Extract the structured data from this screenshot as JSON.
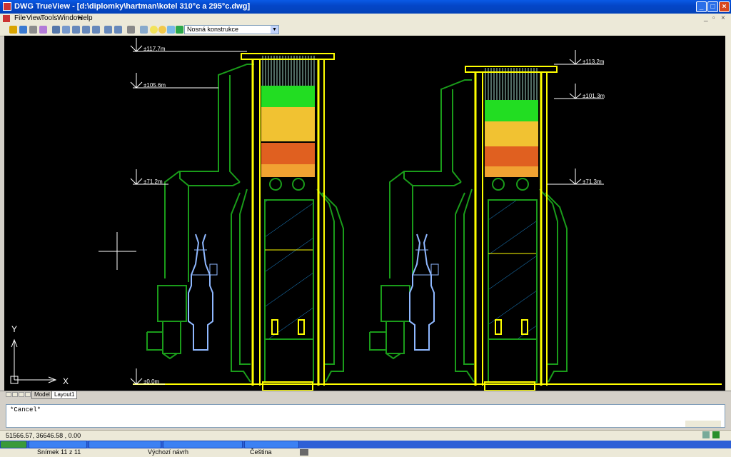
{
  "window": {
    "title": "DWG TrueView - [d:\\diplomky\\hartman\\kotel 310°c a 295°c.dwg]"
  },
  "menu": {
    "items": [
      "File",
      "View",
      "Tools",
      "Window",
      "Help"
    ]
  },
  "toolbar": {
    "layer_value": "Nosná konstrukce"
  },
  "drawing": {
    "left_levels": [
      "±117.7m",
      "±105.6m",
      "±71.2m",
      "±0.0m"
    ],
    "right_levels": [
      "±113.2m",
      "±101.3m",
      "±71.3m"
    ],
    "ucs_y": "Y",
    "ucs_x": "X"
  },
  "tabs": {
    "model": "Model",
    "layout": "Layout1"
  },
  "command": {
    "history": "*Cancel*"
  },
  "status": {
    "coords": "51566.57, 36646.58 , 0.00"
  },
  "lower_bar": {
    "slide": "Snímek 11 z 11",
    "design": "Výchozí návrh",
    "language": "Čeština"
  },
  "colors": {
    "structure": "#1a9c1a",
    "frame": "#ffff00",
    "blue_parts": "#8fb8ff",
    "hatch": "#1a7fc4"
  }
}
